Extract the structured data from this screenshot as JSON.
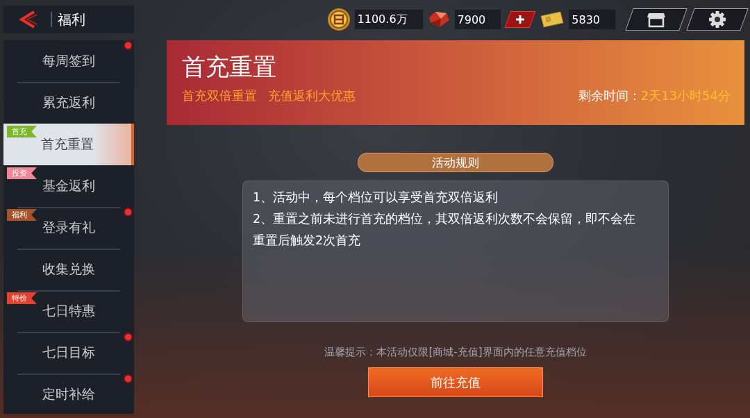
{
  "header": {
    "title": "福利",
    "currencies": [
      {
        "kind": "coin",
        "amount": "1100.6万"
      },
      {
        "kind": "ruby",
        "amount": "7900",
        "add": true
      },
      {
        "kind": "ticket",
        "amount": "5830"
      }
    ]
  },
  "sidebar": {
    "items": [
      {
        "label": "每周签到",
        "selected": false,
        "dot": true
      },
      {
        "label": "累充返利",
        "selected": false,
        "dot": false
      },
      {
        "label": "首充重置",
        "selected": true,
        "dot": false,
        "tag": {
          "text": "首充",
          "color": "#7cb82a"
        }
      },
      {
        "label": "基金返利",
        "selected": false,
        "dot": false,
        "tag": {
          "text": "投资",
          "color": "#f08595"
        }
      },
      {
        "label": "登录有礼",
        "selected": false,
        "dot": true,
        "tag": {
          "text": "福利",
          "color": "#a4532a"
        }
      },
      {
        "label": "收集兑换",
        "selected": false,
        "dot": false
      },
      {
        "label": "七日特惠",
        "selected": false,
        "dot": false,
        "tag": {
          "text": "特价",
          "color": "#e8402f"
        }
      },
      {
        "label": "七日目标",
        "selected": false,
        "dot": true
      },
      {
        "label": "定时补给",
        "selected": false,
        "dot": true
      }
    ]
  },
  "banner": {
    "title": "首充重置",
    "subtitles": [
      "首充双倍重置",
      "充值返利大优惠"
    ],
    "time_label": "剩余时间：",
    "time_value": "2天13小时54分"
  },
  "rules": {
    "heading": "活动规则",
    "lines": [
      "1、活动中，每个档位可以享受首充双倍返利",
      "2、重置之前未进行首充的档位，其双倍返利次数不会保留，即不会在重置后触发2次首充"
    ]
  },
  "tip": "温馨提示：本活动仅限[商城-充值]界面内的任意充值档位",
  "action_button": "前往充值"
}
